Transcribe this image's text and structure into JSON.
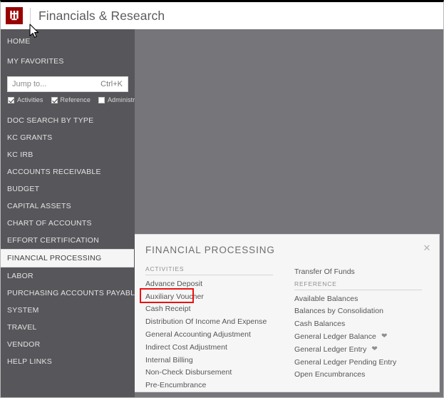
{
  "header": {
    "logo_alt": "iu-trident-logo",
    "title": "Financials & Research"
  },
  "sidebar": {
    "top_items": [
      {
        "label": "HOME",
        "name": "sidebar-item-home"
      },
      {
        "label": "MY FAVORITES",
        "name": "sidebar-item-my-favorites"
      }
    ],
    "search": {
      "placeholder": "Jump to...",
      "value": "",
      "shortcut": "Ctrl+K"
    },
    "filters": [
      {
        "label": "Activities",
        "checked": true
      },
      {
        "label": "Reference",
        "checked": true
      },
      {
        "label": "Administration",
        "checked": false
      }
    ],
    "items": [
      {
        "label": "DOC SEARCH BY TYPE",
        "active": false
      },
      {
        "label": "KC GRANTS",
        "active": false
      },
      {
        "label": "KC IRB",
        "active": false
      },
      {
        "label": "ACCOUNTS RECEIVABLE",
        "active": false
      },
      {
        "label": "BUDGET",
        "active": false
      },
      {
        "label": "CAPITAL ASSETS",
        "active": false
      },
      {
        "label": "CHART OF ACCOUNTS",
        "active": false
      },
      {
        "label": "EFFORT CERTIFICATION",
        "active": false
      },
      {
        "label": "FINANCIAL PROCESSING",
        "active": true
      },
      {
        "label": "LABOR",
        "active": false
      },
      {
        "label": "PURCHASING ACCOUNTS PAYABLES",
        "active": false
      },
      {
        "label": "SYSTEM",
        "active": false
      },
      {
        "label": "TRAVEL",
        "active": false
      },
      {
        "label": "VENDOR",
        "active": false
      },
      {
        "label": "HELP LINKS",
        "active": false
      }
    ]
  },
  "flyout": {
    "title": "FINANCIAL PROCESSING",
    "close_label": "✕",
    "column1": {
      "section_label": "ACTIVITIES",
      "items": [
        {
          "label": "Advance Deposit",
          "favorite": false
        },
        {
          "label": "Auxiliary Voucher",
          "favorite": false
        },
        {
          "label": "Cash Receipt",
          "favorite": false
        },
        {
          "label": "Distribution Of Income And Expense",
          "favorite": false
        },
        {
          "label": "General Accounting Adjustment",
          "favorite": false
        },
        {
          "label": "Indirect Cost Adjustment",
          "favorite": false
        },
        {
          "label": "Internal Billing",
          "favorite": false
        },
        {
          "label": "Non-Check Disbursement",
          "favorite": false
        },
        {
          "label": "Pre-Encumbrance",
          "favorite": false
        }
      ]
    },
    "column2": {
      "overflow_item": {
        "label": "Transfer Of Funds",
        "favorite": false
      },
      "section_label": "REFERENCE",
      "items": [
        {
          "label": "Available Balances",
          "favorite": false
        },
        {
          "label": "Balances by Consolidation",
          "favorite": false
        },
        {
          "label": "Cash Balances",
          "favorite": false
        },
        {
          "label": "General Ledger Balance",
          "favorite": true
        },
        {
          "label": "General Ledger Entry",
          "favorite": true
        },
        {
          "label": "General Ledger Pending Entry",
          "favorite": false
        },
        {
          "label": "Open Encumbrances",
          "favorite": false
        }
      ]
    }
  },
  "annotation": {
    "target_label": "Auxiliary Voucher",
    "color": "#ee1111"
  },
  "colors": {
    "brand_crimson": "#990000",
    "sidebar_bg": "#57565a",
    "backdrop_bg": "#767579",
    "panel_bg": "#f6f6f6",
    "active_item_bg": "#f5f5f5"
  }
}
